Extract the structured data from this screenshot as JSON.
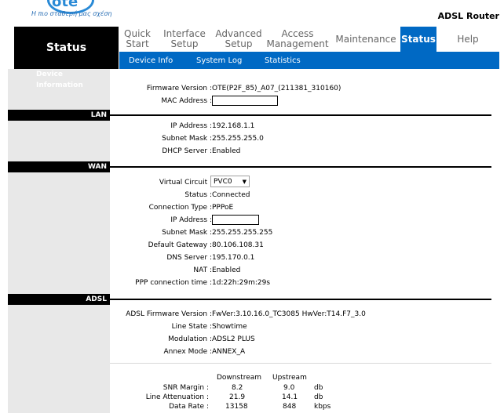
{
  "brand": {
    "logo_text": "ote",
    "tagline": "Η πιο σταθερή μας σχέση",
    "product": "ADSL Router"
  },
  "page_title": "Status",
  "menu": [
    {
      "label_line1": "Quick",
      "label_line2": "Start"
    },
    {
      "label_line1": "Interface",
      "label_line2": "Setup"
    },
    {
      "label_line1": "Advanced",
      "label_line2": "Setup"
    },
    {
      "label_line1": "Access",
      "label_line2": "Management"
    },
    {
      "label_line1": "Maintenance",
      "label_line2": ""
    },
    {
      "label_line1": "Status",
      "label_line2": ""
    },
    {
      "label_line1": "Help",
      "label_line2": ""
    }
  ],
  "submenu": [
    "Device Info",
    "System Log",
    "Statistics"
  ],
  "sections": {
    "device": "Device Information",
    "lan": "LAN",
    "wan": "WAN",
    "adsl": "ADSL"
  },
  "device_info": {
    "firmware_label": "Firmware Version :",
    "firmware_value": "OTE(P2F_85)_A07_(211381_310160)",
    "mac_label": "MAC Address :",
    "mac_value": ""
  },
  "lan": {
    "ip_label": "IP Address :",
    "ip_value": "192.168.1.1",
    "mask_label": "Subnet Mask :",
    "mask_value": "255.255.255.0",
    "dhcp_label": "DHCP Server :",
    "dhcp_value": "Enabled"
  },
  "wan": {
    "vc_label": "Virtual Circuit :",
    "vc_value": "PVC0",
    "status_label": "Status :",
    "status_value": "Connected",
    "conn_label": "Connection Type :",
    "conn_value": "PPPoE",
    "ip_label": "IP Address :",
    "ip_value": "",
    "mask_label": "Subnet Mask :",
    "mask_value": "255.255.255.255",
    "gw_label": "Default Gateway :",
    "gw_value": "80.106.108.31",
    "dns_label": "DNS Server :",
    "dns_value": "195.170.0.1",
    "nat_label": "NAT :",
    "nat_value": "Enabled",
    "ppp_label": "PPP connection time :",
    "ppp_value": "1d:22h:29m:29s"
  },
  "adsl": {
    "fw_label": "ADSL Firmware Version :",
    "fw_value": "FwVer:3.10.16.0_TC3085 HwVer:T14.F7_3.0",
    "line_label": "Line State :",
    "line_value": "Showtime",
    "mod_label": "Modulation :",
    "mod_value": "ADSL2 PLUS",
    "annex_label": "Annex Mode :",
    "annex_value": "ANNEX_A",
    "col_down": "Downstream",
    "col_up": "Upstream",
    "snr_label": "SNR Margin :",
    "snr_down": "8.2",
    "snr_up": "9.0",
    "snr_unit": "db",
    "att_label": "Line Attenuation :",
    "att_down": "21.9",
    "att_up": "14.1",
    "att_unit": "db",
    "rate_label": "Data Rate :",
    "rate_down": "13158",
    "rate_up": "848",
    "rate_unit": "kbps"
  }
}
